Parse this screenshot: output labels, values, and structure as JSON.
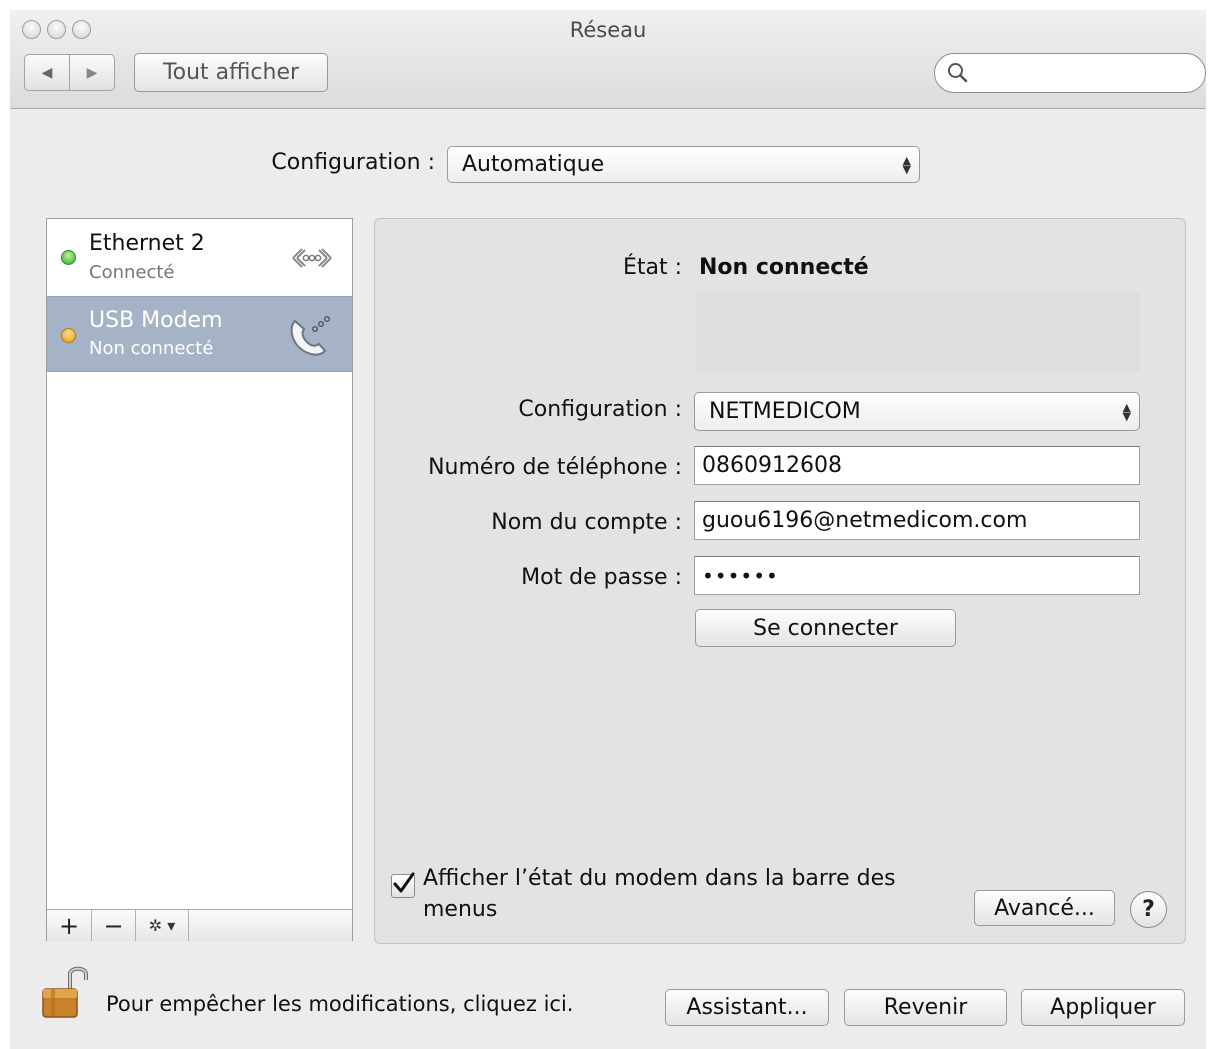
{
  "window": {
    "title": "Réseau"
  },
  "toolbar": {
    "show_all_label": "Tout afficher",
    "search_placeholder": ""
  },
  "location": {
    "label": "Configuration :",
    "value": "Automatique"
  },
  "services": [
    {
      "name": "Ethernet 2",
      "status": "Connecté",
      "dot_color": "#4cc23a",
      "icon": "ethernet-icon"
    },
    {
      "name": "USB Modem",
      "status": "Non connecté",
      "dot_color": "#f0a81e",
      "icon": "modem-phone-icon"
    }
  ],
  "sidebar_tools": {
    "add": "+",
    "remove": "−",
    "action": "✲ ▾"
  },
  "detail": {
    "status_label": "État :",
    "status_value": "Non connecté",
    "configuration_label": "Configuration :",
    "configuration_value": "NETMEDICOM",
    "phone_label": "Numéro de téléphone :",
    "phone_value": "0860912608",
    "account_label": "Nom du compte :",
    "account_value": "guou6196@netmedicom.com",
    "password_label": "Mot de passe :",
    "password_value": "••••••",
    "connect_label": "Se connecter",
    "show_status_label_line1": "Afficher l’état du modem dans la barre des",
    "show_status_label_line2": "menus",
    "show_status_checked": true,
    "advanced_label": "Avancé...",
    "help_label": "?"
  },
  "footer": {
    "lock_text": "Pour empêcher les modifications, cliquez ici.",
    "assistant_label": "Assistant...",
    "revert_label": "Revenir",
    "apply_label": "Appliquer"
  },
  "colors": {
    "selected_row": "#a6b2c6",
    "accent": "#3b79d6"
  }
}
